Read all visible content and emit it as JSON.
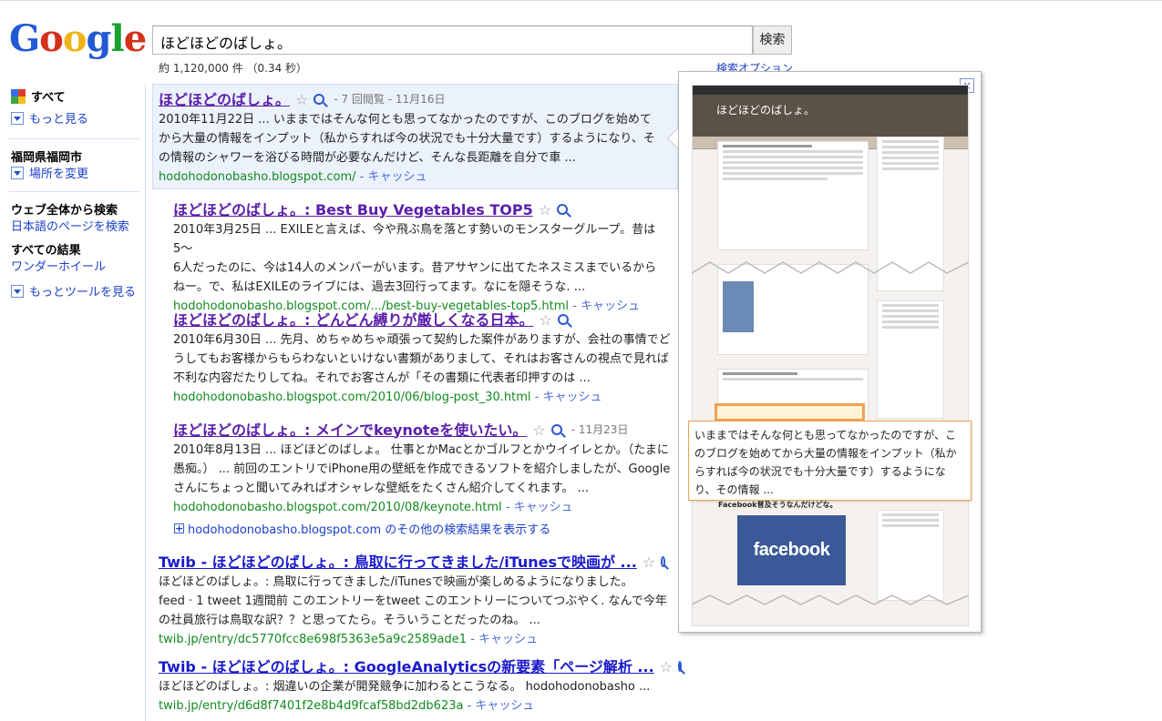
{
  "header": {
    "logo_text": "Google",
    "query": "ほどほどのばしょ。",
    "search_button": "検索",
    "stats": "約 1,120,000 件 （0.34 秒）",
    "advanced_search": "検索オプション"
  },
  "leftnav": {
    "all": "すべて",
    "more": "もっと見る",
    "location": "福岡県福岡市",
    "change_location": "場所を変更",
    "web_heading": "ウェブ全体から検索",
    "japanese_pages": "日本語のページを検索",
    "all_results": "すべての結果",
    "wonder_wheel": "ワンダーホイール",
    "more_tools": "もっとツールを見る"
  },
  "results": [
    {
      "title": "ほどほどのばしょ。",
      "meta": "- 7 回閲覧 - 11月16日",
      "snippet": [
        "2010年11月22日 ... いままではそんな何とも思ってなかったのですが、このブログを始めて",
        "から大量の情報をインプット（私からすれば今の状況でも十分大量です）するようになり、そ",
        "の情報のシャワーを浴びる時間が必要なんだけど、そんな長距離を自分で車 ..."
      ],
      "url": "hodohodonobasho.blogspot.com/",
      "cache": "- キャッシュ"
    },
    {
      "title": "ほどほどのばしょ。: Best Buy Vegetables TOP5",
      "snippet": [
        "2010年3月25日 ... EXILEと言えば、今や飛ぶ鳥を落とす勢いのモンスターグループ。昔は5〜",
        "6人だったのに、今は14人のメンバーがいます。昔アサヤンに出てたネスミスまでいるから",
        "ねー。で、私はEXILEのライブには、過去3回行ってます。なにを隠そうな. ..."
      ],
      "url": "hodohodonobasho.blogspot.com/.../best-buy-vegetables-top5.html",
      "cache": "- キャッシュ"
    },
    {
      "title": "ほどほどのばしょ。: どんどん縛りが厳しくなる日本。",
      "snippet": [
        "2010年6月30日 ... 先月、めちゃめちゃ頑張って契約した案件がありますが、会社の事情でど",
        "うしてもお客様からもらわないといけない書類がありまして、それはお客さんの視点で見れば",
        "不利な内容だたりしてね。それでお客さんが「その書類に代表者印押すのは ..."
      ],
      "url": "hodohodonobasho.blogspot.com/2010/06/blog-post_30.html",
      "cache": "- キャッシュ"
    },
    {
      "title": "ほどほどのばしょ。: メインでkeynoteを使いたい。",
      "meta": "- 11月23日",
      "snippet": [
        "2010年8月13日 ... ほどほどのばしょ。 仕事とかMacとかゴルフとかウイイレとか。（たまに",
        "愚痴。） ... 前回のエントリでiPhone用の壁紙を作成できるソフトを紹介しましたが、Google",
        "さんにちょっと聞いてみればオシャレな壁紙をたくさん紹介してくれます。 ..."
      ],
      "url": "hodohodonobasho.blogspot.com/2010/08/keynote.html",
      "cache": "- キャッシュ"
    },
    {
      "title": "Twib - ほどほどのばしょ。: 鳥取に行ってきました/iTunesで映画が ...",
      "snippet": [
        "ほどほどのばしょ。: 鳥取に行ってきました/iTunesで映画が楽しめるようになりました。",
        "feed · 1 tweet 1週間前 このエントリーをtweet このエントリーについてつぶやく. なんで今年",
        "の社員旅行は鳥取な訳？？と思ってたら。そういうことだったのね。 ..."
      ],
      "url": "twib.jp/entry/dc5770fcc8e698f5363e5a9c2589ade1",
      "cache": "- キャッシュ"
    },
    {
      "title": "Twib - ほどほどのばしょ。: GoogleAnalyticsの新要素「ページ解析 ...",
      "snippet": [
        "ほどほどのばしょ。: 烟違いの企業が開発競争に加わるとこうなる。 hodohodonobasho ..."
      ],
      "url": "twib.jp/entry/d6d8f7401f2e8b4d9fcaf58bd2db623a",
      "cache": "- キャッシュ"
    }
  ],
  "more_results": "hodohodonobasho.blogspot.com のその他の検索結果を表示する",
  "preview": {
    "close": "×",
    "blog_title": "ほどほどのばしょ。",
    "facebook_heading": "Facebook普及そうなんだけどな。",
    "facebook_logo": "facebook",
    "callout": "いままではそんな何とも思ってなかったのですが、このブログを始めてから大量の情報をインプット（私からすれば今の状況でも十分大量です）するようになり、その情報 ..."
  },
  "colors": {
    "link_visited": "#5a1eaa",
    "link": "#1a1acc",
    "url_green": "#138a1f",
    "highlight_bg": "#ebf2fc",
    "callout_border": "#f0a050",
    "facebook_blue": "#3b5998"
  }
}
